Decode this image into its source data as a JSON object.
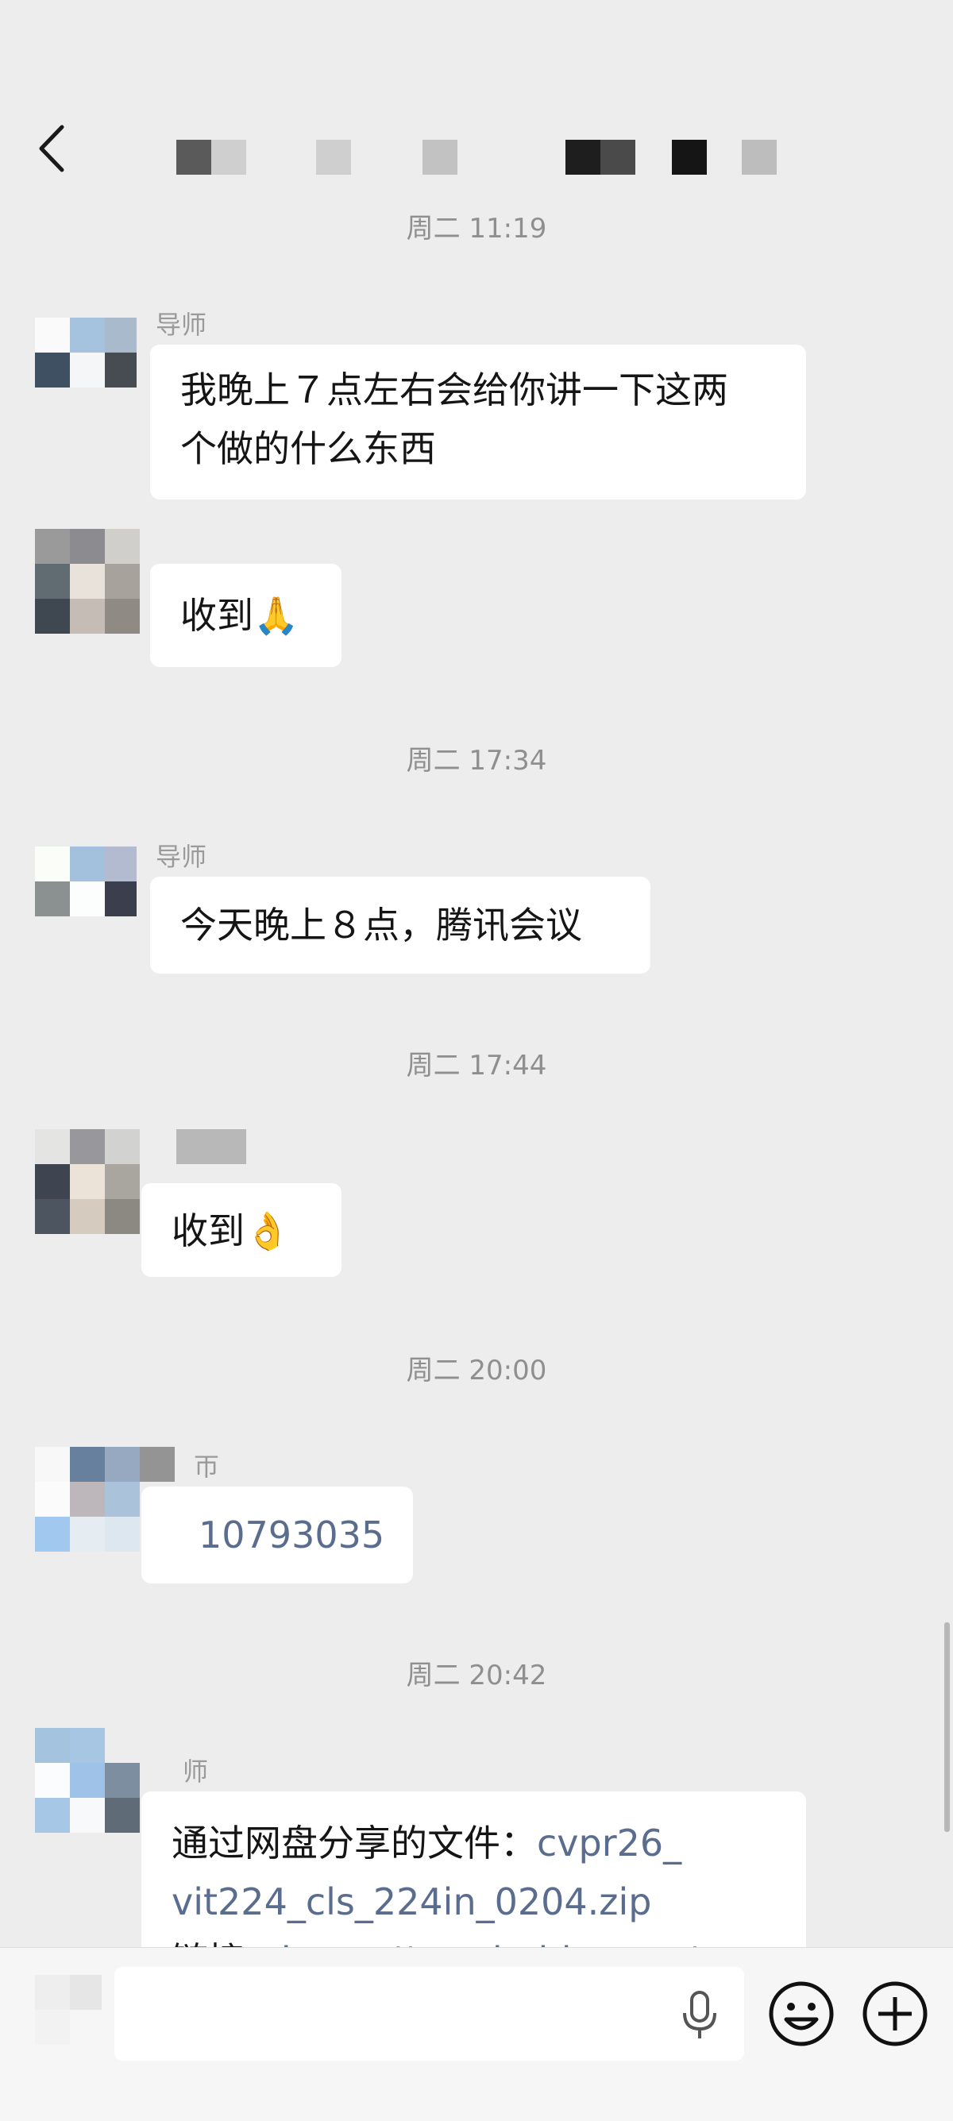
{
  "header": {
    "back_icon": "chevron-left-icon",
    "title_obscured": true
  },
  "messages": [
    {
      "timestamp": "周二 11:19"
    },
    {
      "sender": "导师",
      "text_line1": "我晚上７点左右会给你讲一下这两",
      "text_line2": "个做的什么东西"
    },
    {
      "text": "收到🙏"
    },
    {
      "timestamp": "周二 17:34"
    },
    {
      "sender": "导师",
      "text": "今天晚上８点，腾讯会议"
    },
    {
      "timestamp": "周二 17:44"
    },
    {
      "text": "收到👌"
    },
    {
      "timestamp": "周二 20:00"
    },
    {
      "sender": "帀",
      "text": "10793035"
    },
    {
      "timestamp": "周二 20:42"
    },
    {
      "sender": "师",
      "text_prefix": "通过网盘分享的文件：",
      "file_part1": "cvpr26_",
      "file_part2": "vit224_cls_224in_0204.zip",
      "line3_prefix": "链接：",
      "line3_link": "https://pan.baidu.com/s"
    }
  ],
  "input_bar": {
    "voice_icon": "microphone-icon",
    "emoji_icon": "smiley-icon",
    "more_icon": "plus-circle-icon"
  },
  "colors": {
    "background": "#ededed",
    "bubble": "#ffffff",
    "link": "#5b6d8f",
    "timestamp": "#8f8f8f"
  }
}
